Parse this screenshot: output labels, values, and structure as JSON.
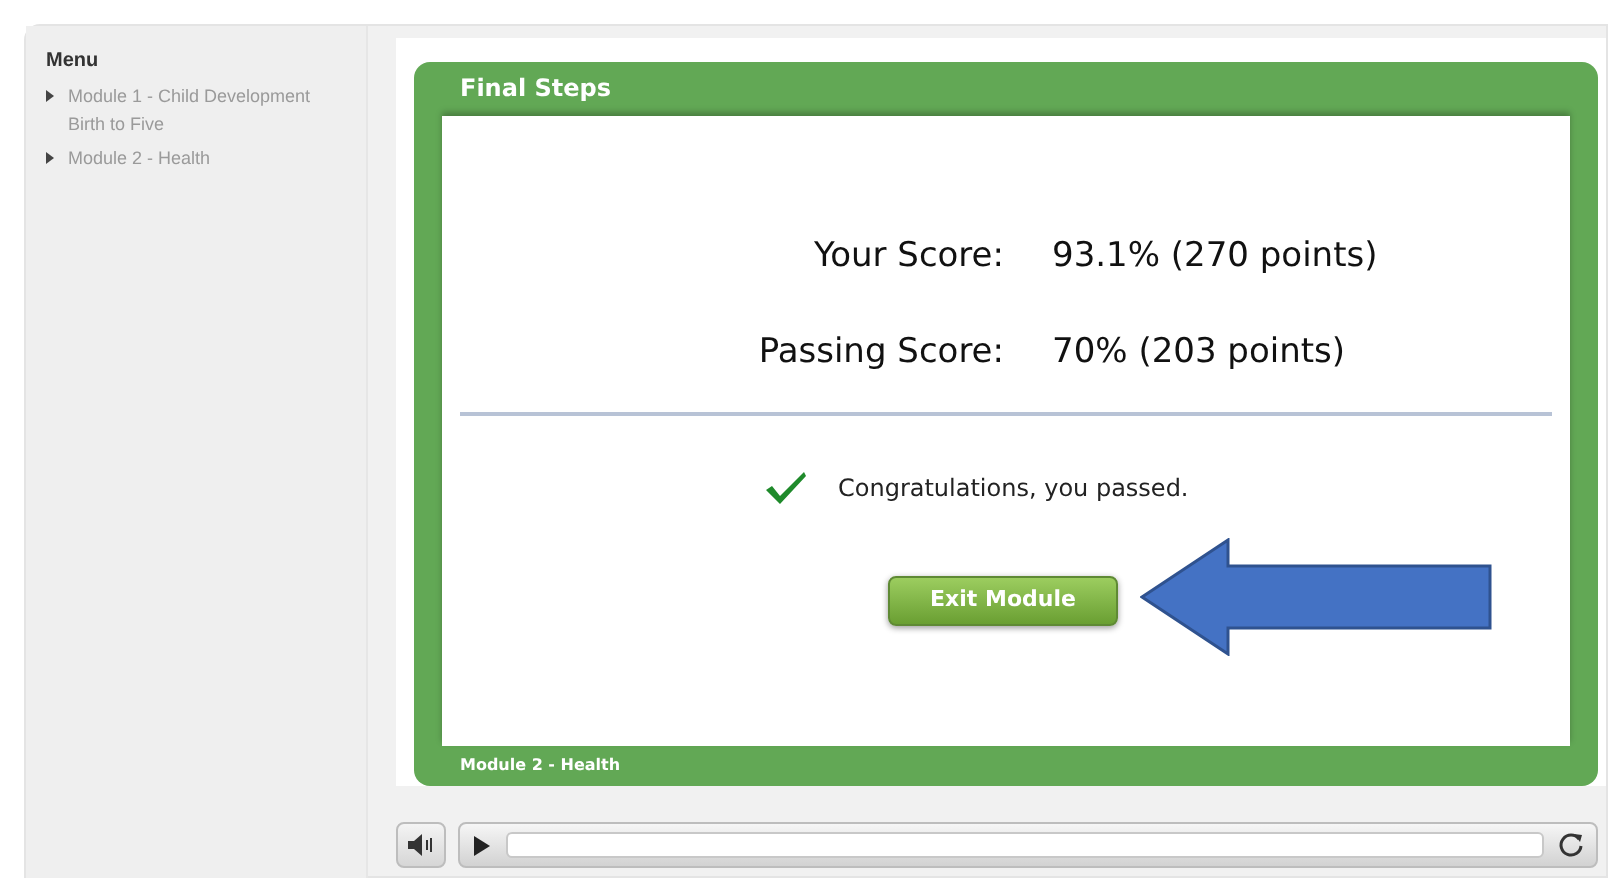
{
  "sidebar": {
    "title": "Menu",
    "items": [
      {
        "label": "Module 1 - Child Development Birth to Five"
      },
      {
        "label": "Module 2 - Health"
      }
    ]
  },
  "slide": {
    "title": "Final Steps",
    "scores": [
      {
        "label": "Your Score:",
        "value": "93.1% (270 points)"
      },
      {
        "label": "Passing Score:",
        "value": "70% (203 points)"
      }
    ],
    "message": "Congratulations, you passed.",
    "button": "Exit Module",
    "footer": "Module 2 - Health"
  }
}
